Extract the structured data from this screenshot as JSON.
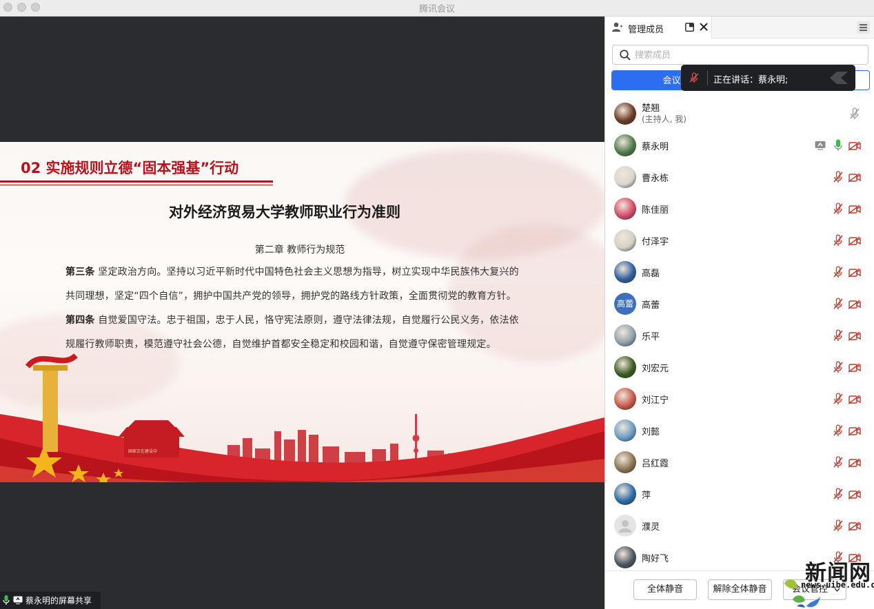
{
  "window": {
    "title": "腾讯会议"
  },
  "slide": {
    "heading": "02 实施规则立德“固本强基”行动",
    "title": "对外经济贸易大学教师职业行为准则",
    "chapter": "第二章 教师行为规范",
    "articles": [
      {
        "label": "第三条",
        "lines": [
          " 坚定政治方向。坚持以习近平新时代中国特色社会主义思想为指导，树立实现中华民族伟大复兴的",
          "共同理想，坚定“四个自信”，拥护中国共产党的领导，拥护党的路线方针政策，全面贯彻党的教育方针。"
        ]
      },
      {
        "label": "第四条",
        "lines": [
          " 自觉爱国守法。忠于祖国，忠于人民，恪守宪法原则，遵守法律法规，自觉履行公民义务，依法依",
          "规履行教师职责，模范遵守社会公德，自觉维护首都安全稳定和校园和谐，自觉遵守保密管理规定。"
        ]
      }
    ],
    "banner_text": "国家正在建设中"
  },
  "share_status": {
    "label": "蔡永明的屏幕共享"
  },
  "panel": {
    "tab_label": "管理成员",
    "search_placeholder": "搜索成员",
    "segment_active": "会议中",
    "toast": "正在讲话：蔡永明;",
    "members": [
      {
        "name": "楚翘",
        "sub": "(主持人, 我)",
        "avatar": "photo",
        "avatar_color": "#6b3a24",
        "mic": "muted-gray",
        "video": "none",
        "share": false
      },
      {
        "name": "蔡永明",
        "sub": "",
        "avatar": "photo",
        "avatar_color": "#4d7a4a",
        "mic": "active",
        "video": "off",
        "share": true
      },
      {
        "name": "曹永栋",
        "sub": "",
        "avatar": "photo",
        "avatar_color": "#d9d6d0",
        "mic": "muted",
        "video": "off",
        "share": false
      },
      {
        "name": "陈佳丽",
        "sub": "",
        "avatar": "photo",
        "avatar_color": "#d64a6a",
        "mic": "muted",
        "video": "off",
        "share": false
      },
      {
        "name": "付泽宇",
        "sub": "",
        "avatar": "photo",
        "avatar_color": "#cfd3c4",
        "mic": "muted",
        "video": "off",
        "share": false
      },
      {
        "name": "高磊",
        "sub": "",
        "avatar": "photo",
        "avatar_color": "#2f5f9c",
        "mic": "muted",
        "video": "off",
        "share": false
      },
      {
        "name": "高蕾",
        "sub": "",
        "avatar": "initials",
        "initials": "高蕾",
        "avatar_color": "#3e6fbd",
        "mic": "muted",
        "video": "off",
        "share": false
      },
      {
        "name": "乐平",
        "sub": "",
        "avatar": "photo",
        "avatar_color": "#8fa0ab",
        "mic": "muted",
        "video": "off",
        "share": false
      },
      {
        "name": "刘宏元",
        "sub": "",
        "avatar": "photo",
        "avatar_color": "#3a5a22",
        "mic": "muted",
        "video": "off",
        "share": false
      },
      {
        "name": "刘江宁",
        "sub": "",
        "avatar": "photo",
        "avatar_color": "#c8574a",
        "mic": "muted",
        "video": "off",
        "share": false
      },
      {
        "name": "刘懿",
        "sub": "",
        "avatar": "photo",
        "avatar_color": "#6a9cc4",
        "mic": "muted",
        "video": "off",
        "share": false
      },
      {
        "name": "吕红霞",
        "sub": "",
        "avatar": "photo",
        "avatar_color": "#8a7450",
        "mic": "muted",
        "video": "off",
        "share": false
      },
      {
        "name": "萍",
        "sub": "",
        "avatar": "photo",
        "avatar_color": "#2a6aa8",
        "mic": "muted",
        "video": "off",
        "share": false
      },
      {
        "name": "濮灵",
        "sub": "",
        "avatar": "default",
        "avatar_color": "#e4e4e4",
        "mic": "muted",
        "video": "off",
        "share": false
      },
      {
        "name": "陶好飞",
        "sub": "",
        "avatar": "photo",
        "avatar_color": "#4a5560",
        "mic": "muted",
        "video": "off",
        "share": false
      }
    ],
    "footer": {
      "mute_all": "全体静音",
      "unmute_all": "解除全体静音",
      "controls": "会议管控"
    }
  },
  "watermark": {
    "big": "新闻网",
    "url": "news.uibe.edu.cn"
  },
  "colors": {
    "accent": "#2d6ef0",
    "slide_red": "#b8131a",
    "mic_active": "#3dbb4d",
    "mic_muted": "#c0392b"
  }
}
